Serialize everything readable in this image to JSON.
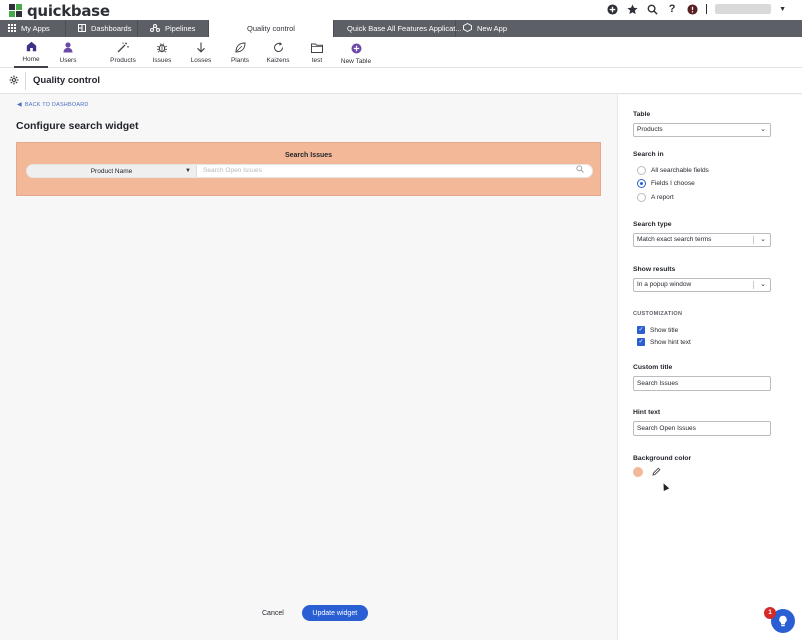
{
  "brand": {
    "name": "quickbase"
  },
  "topbar": {
    "icons": [
      "add-icon",
      "star-icon",
      "search-icon",
      "help-icon",
      "alert-icon"
    ]
  },
  "apps_bar": {
    "tabs": [
      {
        "label": "My Apps",
        "icon": "grid-icon"
      },
      {
        "label": "Dashboards",
        "icon": "dashboard-icon"
      },
      {
        "label": "Pipelines",
        "icon": "pipelines-icon"
      },
      {
        "label": "Quality control",
        "icon": ""
      },
      {
        "label": "Quick Base All Features Applicat...",
        "icon": ""
      },
      {
        "label": "New App",
        "icon": "new-app-icon"
      }
    ]
  },
  "table_bar": {
    "items": [
      {
        "label": "Home",
        "icon": "home-icon"
      },
      {
        "label": "Users",
        "icon": "user-icon"
      },
      {
        "label": "Products",
        "icon": "wand-icon"
      },
      {
        "label": "Issues",
        "icon": "bug-icon"
      },
      {
        "label": "Losses",
        "icon": "arrow-down-icon"
      },
      {
        "label": "Plants",
        "icon": "leaf-icon"
      },
      {
        "label": "Kaizens",
        "icon": "refresh-icon"
      },
      {
        "label": "test",
        "icon": "folder-icon"
      },
      {
        "label": "New Table",
        "icon": "plus-circle-icon"
      }
    ]
  },
  "subheader": {
    "title": "Quality control"
  },
  "main": {
    "back_link": "BACK TO DASHBOARD",
    "title": "Configure search widget",
    "widget": {
      "title": "Search Issues",
      "field": "Product Name",
      "placeholder": "Search Open Issues",
      "bg_color": "#f3b898"
    },
    "cancel_label": "Cancel",
    "update_label": "Update widget"
  },
  "panel": {
    "table_label": "Table",
    "table_value": "Products",
    "search_in_label": "Search in",
    "search_in_options": [
      "All searchable fields",
      "Fields I choose",
      "A report"
    ],
    "search_in_selected": 1,
    "search_type_label": "Search type",
    "search_type_value": "Match exact search terms",
    "show_results_label": "Show results",
    "show_results_value": "In a popup window",
    "customization_label": "CUSTOMIZATION",
    "show_title_label": "Show title",
    "show_hint_label": "Show hint text",
    "custom_title_label": "Custom title",
    "custom_title_value": "Search Issues",
    "hint_text_label": "Hint text",
    "hint_text_value": "Search Open Issues",
    "bg_color_label": "Background color"
  },
  "help": {
    "badge": "1"
  },
  "colors": {
    "accent": "#2a5fd4",
    "widget_bg": "#f3b898",
    "appsbar": "#5c5f66"
  }
}
